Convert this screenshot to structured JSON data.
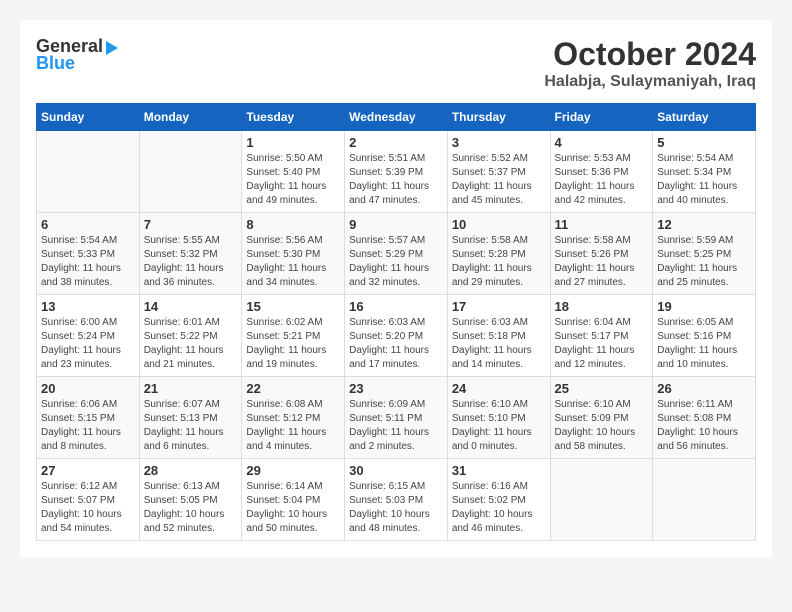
{
  "header": {
    "logo_general": "General",
    "logo_blue": "Blue",
    "month_title": "October 2024",
    "location": "Halabja, Sulaymaniyah, Iraq"
  },
  "days_of_week": [
    "Sunday",
    "Monday",
    "Tuesday",
    "Wednesday",
    "Thursday",
    "Friday",
    "Saturday"
  ],
  "weeks": [
    [
      {
        "day": "",
        "info": ""
      },
      {
        "day": "",
        "info": ""
      },
      {
        "day": "1",
        "info": "Sunrise: 5:50 AM\nSunset: 5:40 PM\nDaylight: 11 hours and 49 minutes."
      },
      {
        "day": "2",
        "info": "Sunrise: 5:51 AM\nSunset: 5:39 PM\nDaylight: 11 hours and 47 minutes."
      },
      {
        "day": "3",
        "info": "Sunrise: 5:52 AM\nSunset: 5:37 PM\nDaylight: 11 hours and 45 minutes."
      },
      {
        "day": "4",
        "info": "Sunrise: 5:53 AM\nSunset: 5:36 PM\nDaylight: 11 hours and 42 minutes."
      },
      {
        "day": "5",
        "info": "Sunrise: 5:54 AM\nSunset: 5:34 PM\nDaylight: 11 hours and 40 minutes."
      }
    ],
    [
      {
        "day": "6",
        "info": "Sunrise: 5:54 AM\nSunset: 5:33 PM\nDaylight: 11 hours and 38 minutes."
      },
      {
        "day": "7",
        "info": "Sunrise: 5:55 AM\nSunset: 5:32 PM\nDaylight: 11 hours and 36 minutes."
      },
      {
        "day": "8",
        "info": "Sunrise: 5:56 AM\nSunset: 5:30 PM\nDaylight: 11 hours and 34 minutes."
      },
      {
        "day": "9",
        "info": "Sunrise: 5:57 AM\nSunset: 5:29 PM\nDaylight: 11 hours and 32 minutes."
      },
      {
        "day": "10",
        "info": "Sunrise: 5:58 AM\nSunset: 5:28 PM\nDaylight: 11 hours and 29 minutes."
      },
      {
        "day": "11",
        "info": "Sunrise: 5:58 AM\nSunset: 5:26 PM\nDaylight: 11 hours and 27 minutes."
      },
      {
        "day": "12",
        "info": "Sunrise: 5:59 AM\nSunset: 5:25 PM\nDaylight: 11 hours and 25 minutes."
      }
    ],
    [
      {
        "day": "13",
        "info": "Sunrise: 6:00 AM\nSunset: 5:24 PM\nDaylight: 11 hours and 23 minutes."
      },
      {
        "day": "14",
        "info": "Sunrise: 6:01 AM\nSunset: 5:22 PM\nDaylight: 11 hours and 21 minutes."
      },
      {
        "day": "15",
        "info": "Sunrise: 6:02 AM\nSunset: 5:21 PM\nDaylight: 11 hours and 19 minutes."
      },
      {
        "day": "16",
        "info": "Sunrise: 6:03 AM\nSunset: 5:20 PM\nDaylight: 11 hours and 17 minutes."
      },
      {
        "day": "17",
        "info": "Sunrise: 6:03 AM\nSunset: 5:18 PM\nDaylight: 11 hours and 14 minutes."
      },
      {
        "day": "18",
        "info": "Sunrise: 6:04 AM\nSunset: 5:17 PM\nDaylight: 11 hours and 12 minutes."
      },
      {
        "day": "19",
        "info": "Sunrise: 6:05 AM\nSunset: 5:16 PM\nDaylight: 11 hours and 10 minutes."
      }
    ],
    [
      {
        "day": "20",
        "info": "Sunrise: 6:06 AM\nSunset: 5:15 PM\nDaylight: 11 hours and 8 minutes."
      },
      {
        "day": "21",
        "info": "Sunrise: 6:07 AM\nSunset: 5:13 PM\nDaylight: 11 hours and 6 minutes."
      },
      {
        "day": "22",
        "info": "Sunrise: 6:08 AM\nSunset: 5:12 PM\nDaylight: 11 hours and 4 minutes."
      },
      {
        "day": "23",
        "info": "Sunrise: 6:09 AM\nSunset: 5:11 PM\nDaylight: 11 hours and 2 minutes."
      },
      {
        "day": "24",
        "info": "Sunrise: 6:10 AM\nSunset: 5:10 PM\nDaylight: 11 hours and 0 minutes."
      },
      {
        "day": "25",
        "info": "Sunrise: 6:10 AM\nSunset: 5:09 PM\nDaylight: 10 hours and 58 minutes."
      },
      {
        "day": "26",
        "info": "Sunrise: 6:11 AM\nSunset: 5:08 PM\nDaylight: 10 hours and 56 minutes."
      }
    ],
    [
      {
        "day": "27",
        "info": "Sunrise: 6:12 AM\nSunset: 5:07 PM\nDaylight: 10 hours and 54 minutes."
      },
      {
        "day": "28",
        "info": "Sunrise: 6:13 AM\nSunset: 5:05 PM\nDaylight: 10 hours and 52 minutes."
      },
      {
        "day": "29",
        "info": "Sunrise: 6:14 AM\nSunset: 5:04 PM\nDaylight: 10 hours and 50 minutes."
      },
      {
        "day": "30",
        "info": "Sunrise: 6:15 AM\nSunset: 5:03 PM\nDaylight: 10 hours and 48 minutes."
      },
      {
        "day": "31",
        "info": "Sunrise: 6:16 AM\nSunset: 5:02 PM\nDaylight: 10 hours and 46 minutes."
      },
      {
        "day": "",
        "info": ""
      },
      {
        "day": "",
        "info": ""
      }
    ]
  ]
}
